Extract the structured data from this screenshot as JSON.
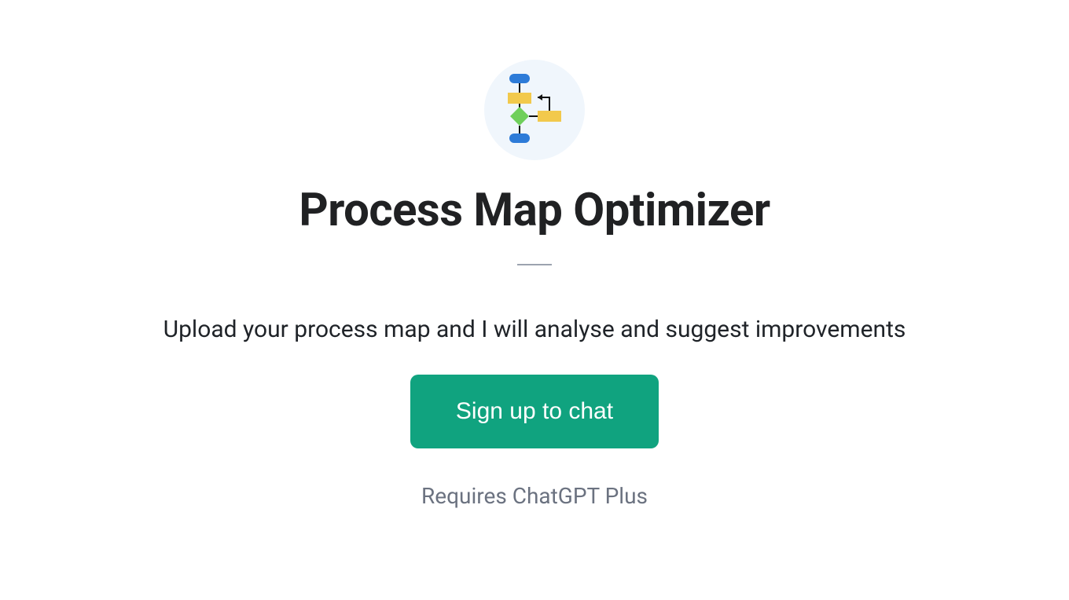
{
  "app": {
    "title": "Process Map Optimizer",
    "description": "Upload your process map and I will analyse and suggest improvements",
    "signup_button_label": "Sign up to chat",
    "requires_text": "Requires ChatGPT Plus"
  }
}
